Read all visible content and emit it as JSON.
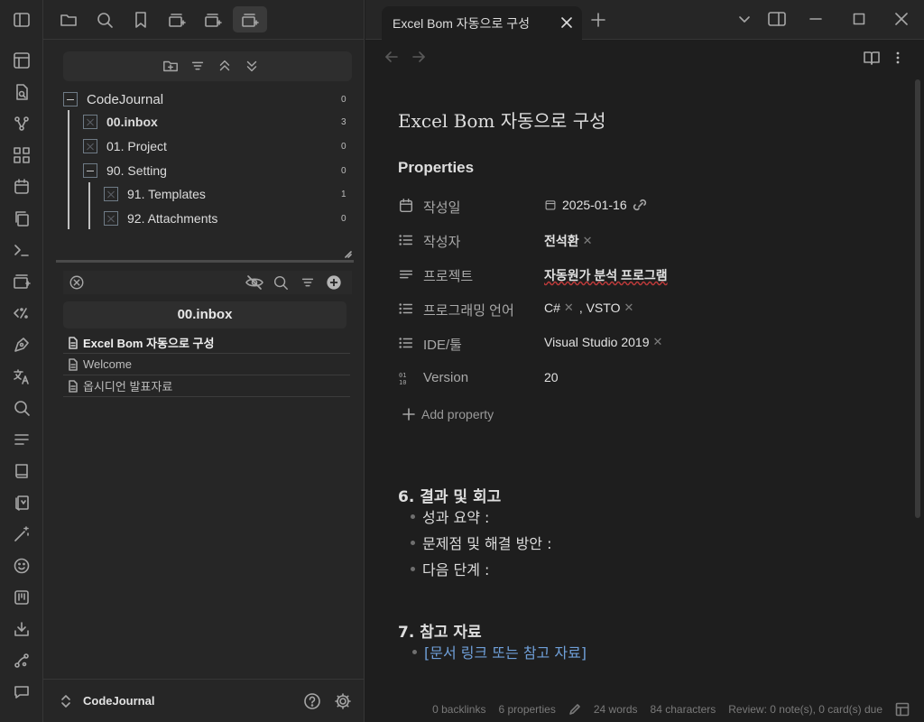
{
  "icons": {
    "ribbon": [
      "layout-icon",
      "file-search-icon",
      "graph-icon",
      "grid-icon",
      "calendar-icon",
      "copy-icon",
      "terminal-icon",
      "add-card-icon",
      "regex-icon",
      "pen-icon",
      "translate-icon",
      "search-icon",
      "list-icon",
      "book-icon",
      "cards-icon",
      "magic-wand-icon",
      "smile-icon",
      "kanban-icon",
      "download-icon",
      "git-icon",
      "comment-icon"
    ]
  },
  "folder_tree": {
    "items": [
      {
        "label": "CodeJournal",
        "count": "0"
      },
      {
        "label": "00.inbox",
        "count": "3"
      },
      {
        "label": "01. Project",
        "count": "0"
      },
      {
        "label": "90. Setting",
        "count": "0"
      },
      {
        "label": "91. Templates",
        "count": "1"
      },
      {
        "label": "92. Attachments",
        "count": "0"
      }
    ]
  },
  "file_pane": {
    "folder": "00.inbox",
    "files": [
      "Excel Bom 자동으로 구성",
      "Welcome",
      "옵시디언 발표자료"
    ]
  },
  "vault": {
    "name": "CodeJournal"
  },
  "tab": {
    "title": "Excel Bom 자동으로 구성"
  },
  "note": {
    "title": "Excel Bom 자동으로 구성",
    "properties_heading": "Properties",
    "properties": [
      {
        "key": "작성일",
        "value": "2025-01-16"
      },
      {
        "key": "작성자",
        "value": "전석환"
      },
      {
        "key": "프로젝트",
        "value": "자동원가 분석 프로그램"
      },
      {
        "key": "프로그래밍 언어",
        "value": "C#",
        "value2": ", VSTO"
      },
      {
        "key": "IDE/툴",
        "value": "Visual Studio 2019"
      },
      {
        "key": "Version",
        "value": "20"
      }
    ],
    "add_property": "Add property",
    "section6": "6. 결과 및 회고",
    "bullets6": [
      "성과 요약 :",
      "문제점 및 해결 방안 :",
      "다음 단계 :"
    ],
    "section7": "7. 참고 자료",
    "bullet7": "[문서 링크 또는 참고 자료]"
  },
  "status": {
    "backlinks": "0 backlinks",
    "properties": "6 properties",
    "words": "24 words",
    "characters": "84 characters",
    "review": "Review: 0 note(s), 0 card(s) due"
  },
  "colors": {
    "accent": "#7f6df2",
    "link": "#6f9fd8",
    "background": "#1e1e1e",
    "panel": "#262626"
  }
}
